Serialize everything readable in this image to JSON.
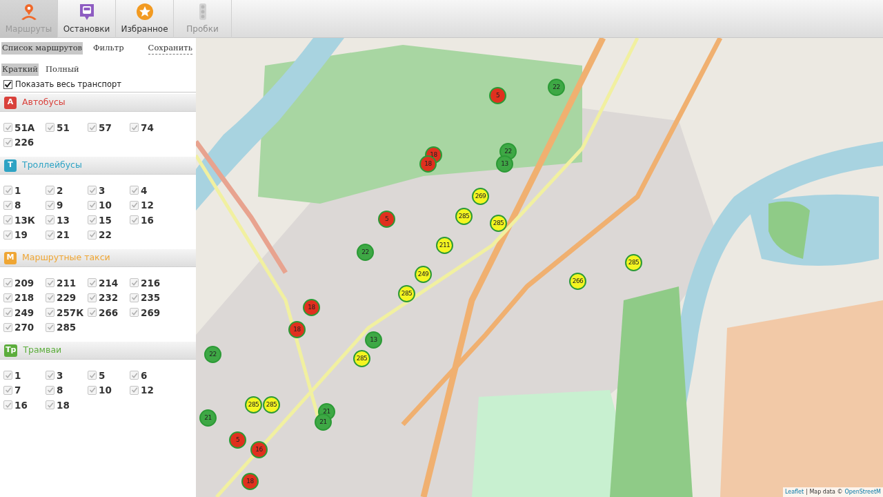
{
  "tabs": [
    {
      "label": "Маршруты",
      "kind": "pin",
      "selected": true,
      "disabled": false
    },
    {
      "label": "Остановки",
      "kind": "bus",
      "selected": false,
      "disabled": false
    },
    {
      "label": "Избранное",
      "kind": "star",
      "selected": false,
      "disabled": false
    },
    {
      "label": "Пробки",
      "kind": "traffic",
      "selected": false,
      "disabled": true
    }
  ],
  "list_tabs": [
    {
      "label": "Список маршрутов",
      "selected": true
    },
    {
      "label": "Фильтр",
      "selected": false
    }
  ],
  "save_link": "Сохранить",
  "view_modes": [
    {
      "label": "Краткий",
      "selected": true
    },
    {
      "label": "Полный",
      "selected": false
    }
  ],
  "show_all": {
    "label": "Показать весь транспорт",
    "checked": true
  },
  "categories": [
    {
      "badge": "А",
      "name": "Автобусы",
      "color": "#d9413b",
      "routes": [
        {
          "label": "51А",
          "checked": true
        },
        {
          "label": "51",
          "checked": true
        },
        {
          "label": "57",
          "checked": true
        },
        {
          "label": "74",
          "checked": true
        },
        {
          "label": "226",
          "checked": true
        }
      ]
    },
    {
      "badge": "Т",
      "name": "Троллейбусы",
      "color": "#2ea3c4",
      "routes": [
        {
          "label": "1",
          "checked": true
        },
        {
          "label": "2",
          "checked": true
        },
        {
          "label": "3",
          "checked": true
        },
        {
          "label": "4",
          "checked": true
        },
        {
          "label": "8",
          "checked": true
        },
        {
          "label": "9",
          "checked": true
        },
        {
          "label": "10",
          "checked": true
        },
        {
          "label": "12",
          "checked": true
        },
        {
          "label": "13К",
          "checked": true
        },
        {
          "label": "13",
          "checked": true
        },
        {
          "label": "15",
          "checked": true
        },
        {
          "label": "16",
          "checked": true
        },
        {
          "label": "19",
          "checked": true
        },
        {
          "label": "21",
          "checked": true
        },
        {
          "label": "22",
          "checked": true
        }
      ]
    },
    {
      "badge": "М",
      "name": "Маршрутные такси",
      "color": "#efa634",
      "routes": [
        {
          "label": "209",
          "checked": true
        },
        {
          "label": "211",
          "checked": true
        },
        {
          "label": "214",
          "checked": true
        },
        {
          "label": "216",
          "checked": true
        },
        {
          "label": "218",
          "checked": true
        },
        {
          "label": "229",
          "checked": true
        },
        {
          "label": "232",
          "checked": true
        },
        {
          "label": "235",
          "checked": true
        },
        {
          "label": "249",
          "checked": true
        },
        {
          "label": "257К",
          "checked": true
        },
        {
          "label": "266",
          "checked": true
        },
        {
          "label": "269",
          "checked": true
        },
        {
          "label": "270",
          "checked": true
        },
        {
          "label": "285",
          "checked": true
        }
      ]
    },
    {
      "badge": "Тр",
      "name": "Трамваи",
      "color": "#5cad3c",
      "routes": [
        {
          "label": "1",
          "checked": true
        },
        {
          "label": "3",
          "checked": true
        },
        {
          "label": "5",
          "checked": true
        },
        {
          "label": "6",
          "checked": true
        },
        {
          "label": "7",
          "checked": true
        },
        {
          "label": "8",
          "checked": true
        },
        {
          "label": "10",
          "checked": true
        },
        {
          "label": "12",
          "checked": true
        },
        {
          "label": "16",
          "checked": true
        },
        {
          "label": "18",
          "checked": true
        }
      ]
    }
  ],
  "map": {
    "markers": [
      {
        "label": "5",
        "color": "#e0301e"
      },
      {
        "label": "22",
        "color": "#3ea845"
      },
      {
        "label": "18",
        "color": "#e0301e"
      },
      {
        "label": "18",
        "color": "#e0301e"
      },
      {
        "label": "22",
        "color": "#3ea845"
      },
      {
        "label": "13",
        "color": "#3ea845"
      },
      {
        "label": "269",
        "color": "#f4f520"
      },
      {
        "label": "285",
        "color": "#f4f520"
      },
      {
        "label": "285",
        "color": "#f4f520"
      },
      {
        "label": "5",
        "color": "#e0301e"
      },
      {
        "label": "22",
        "color": "#3ea845"
      },
      {
        "label": "211",
        "color": "#f4f520"
      },
      {
        "label": "249",
        "color": "#f4f520"
      },
      {
        "label": "285",
        "color": "#f4f520"
      },
      {
        "label": "18",
        "color": "#e0301e"
      },
      {
        "label": "18",
        "color": "#e0301e"
      },
      {
        "label": "13",
        "color": "#3ea845"
      },
      {
        "label": "285",
        "color": "#f4f520"
      },
      {
        "label": "22",
        "color": "#3ea845"
      },
      {
        "label": "285",
        "color": "#f4f520"
      },
      {
        "label": "285",
        "color": "#f4f520"
      },
      {
        "label": "21",
        "color": "#3ea845"
      },
      {
        "label": "21",
        "color": "#3ea845"
      },
      {
        "label": "21",
        "color": "#3ea845"
      },
      {
        "label": "5",
        "color": "#e0301e"
      },
      {
        "label": "16",
        "color": "#e0301e"
      },
      {
        "label": "18",
        "color": "#e0301e"
      },
      {
        "label": "285",
        "color": "#f4f520"
      },
      {
        "label": "266",
        "color": "#f4f520"
      }
    ],
    "attribution": {
      "links": [
        "Leaflet",
        "OpenStreetM"
      ],
      "text": "| Map data ©"
    }
  }
}
